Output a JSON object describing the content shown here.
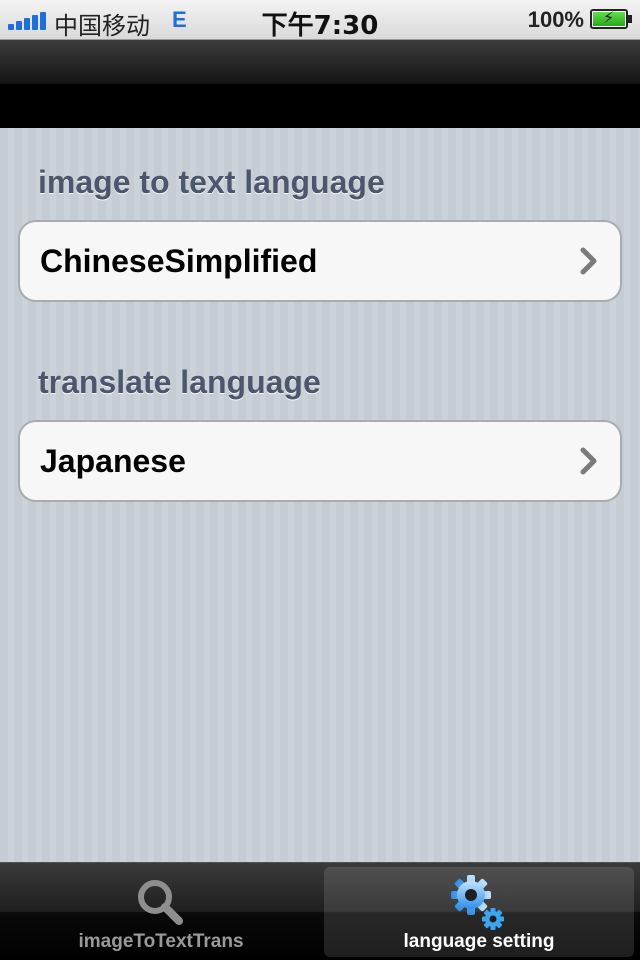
{
  "status_bar": {
    "carrier": "中国移动",
    "network": "E",
    "time": "下午7:30",
    "battery": "100%"
  },
  "sections": [
    {
      "header": "image to text language",
      "value": "ChineseSimplified"
    },
    {
      "header": "translate language",
      "value": "Japanese"
    }
  ],
  "tab_bar": {
    "tabs": [
      {
        "label": "imageToTextTrans",
        "icon": "magnifier-icon",
        "selected": false
      },
      {
        "label": "language setting",
        "icon": "gears-icon",
        "selected": true
      }
    ]
  },
  "colors": {
    "accent": "#1e6fd9",
    "section_header": "#4c566c",
    "background": "#c5ccd4"
  }
}
